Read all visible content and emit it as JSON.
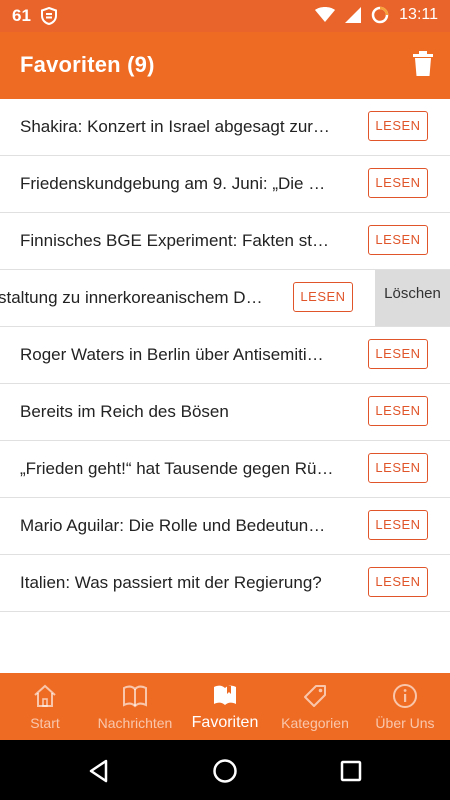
{
  "status_bar": {
    "left_number": "61",
    "time": "13:11"
  },
  "app_bar": {
    "title": "Favoriten (9)"
  },
  "favorites": [
    {
      "title": "Shakira: Konzert in Israel abgesagt zur…",
      "action": "LESEN"
    },
    {
      "title": "Friedenskundgebung am 9. Juni: „Die …",
      "action": "LESEN"
    },
    {
      "title": "Finnisches BGE Experiment: Fakten st…",
      "action": "LESEN"
    },
    {
      "title": "staltung zu innerkoreanischem D…",
      "action": "LESEN",
      "swiped": true,
      "delete_label": "Löschen"
    },
    {
      "title": "Roger Waters in Berlin über Antisemiti…",
      "action": "LESEN"
    },
    {
      "title": "Bereits im Reich des Bösen",
      "action": "LESEN"
    },
    {
      "title": "„Frieden geht!“ hat Tausende gegen Rü…",
      "action": "LESEN"
    },
    {
      "title": "Mario Aguilar: Die Rolle und Bedeutun…",
      "action": "LESEN"
    },
    {
      "title": "Italien: Was passiert mit der Regierung?",
      "action": "LESEN"
    }
  ],
  "bottom_nav": {
    "active": "Favoriten",
    "items": [
      {
        "label": "Start",
        "icon": "home-icon"
      },
      {
        "label": "Nachrichten",
        "icon": "book-icon"
      },
      {
        "label": "Favoriten",
        "icon": "bookmark-book-icon"
      },
      {
        "label": "Kategorien",
        "icon": "tag-icon"
      },
      {
        "label": "Über Uns",
        "icon": "info-icon"
      }
    ]
  },
  "colors": {
    "primary": "#ee6b24",
    "accent": "#e0552a",
    "status_bar": "#e8642a"
  }
}
